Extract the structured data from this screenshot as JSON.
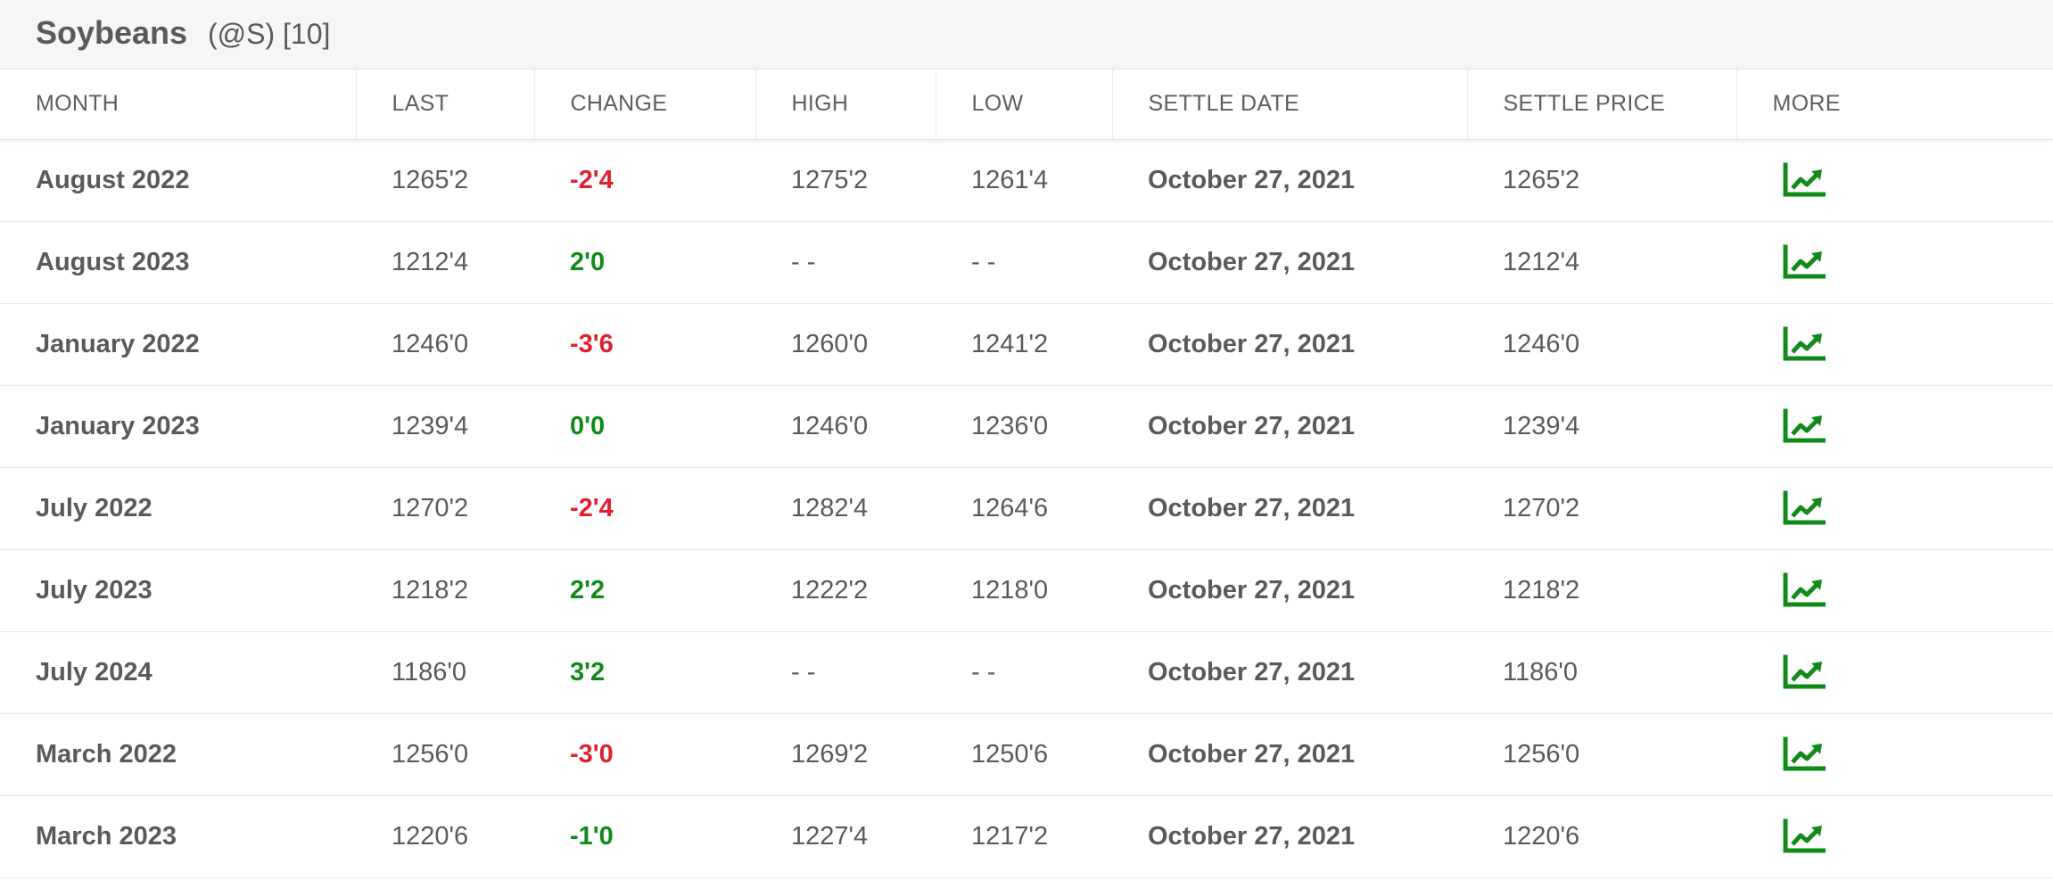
{
  "header": {
    "title": "Soybeans",
    "subtitle": "(@S) [10]"
  },
  "columns": [
    "MONTH",
    "LAST",
    "CHANGE",
    "HIGH",
    "LOW",
    "SETTLE DATE",
    "SETTLE PRICE",
    "MORE"
  ],
  "colors": {
    "negative": "#e0202e",
    "positive": "#118a19",
    "icon": "#118a19"
  },
  "rows": [
    {
      "month": "August 2022",
      "last": "1265'2",
      "change": "-2'4",
      "direction": "down",
      "high": "1275'2",
      "low": "1261'4",
      "settle_date": "October 27, 2021",
      "settle_price": "1265'2",
      "more_icon": "chart-line-icon"
    },
    {
      "month": "August 2023",
      "last": "1212'4",
      "change": "2'0",
      "direction": "up",
      "high": "- -",
      "low": "- -",
      "settle_date": "October 27, 2021",
      "settle_price": "1212'4",
      "more_icon": "chart-line-icon"
    },
    {
      "month": "January 2022",
      "last": "1246'0",
      "change": "-3'6",
      "direction": "down",
      "high": "1260'0",
      "low": "1241'2",
      "settle_date": "October 27, 2021",
      "settle_price": "1246'0",
      "more_icon": "chart-line-icon"
    },
    {
      "month": "January 2023",
      "last": "1239'4",
      "change": "0'0",
      "direction": "up",
      "high": "1246'0",
      "low": "1236'0",
      "settle_date": "October 27, 2021",
      "settle_price": "1239'4",
      "more_icon": "chart-line-icon"
    },
    {
      "month": "July 2022",
      "last": "1270'2",
      "change": "-2'4",
      "direction": "down",
      "high": "1282'4",
      "low": "1264'6",
      "settle_date": "October 27, 2021",
      "settle_price": "1270'2",
      "more_icon": "chart-line-icon"
    },
    {
      "month": "July 2023",
      "last": "1218'2",
      "change": "2'2",
      "direction": "up",
      "high": "1222'2",
      "low": "1218'0",
      "settle_date": "October 27, 2021",
      "settle_price": "1218'2",
      "more_icon": "chart-line-icon"
    },
    {
      "month": "July 2024",
      "last": "1186'0",
      "change": "3'2",
      "direction": "up",
      "high": "- -",
      "low": "- -",
      "settle_date": "October 27, 2021",
      "settle_price": "1186'0",
      "more_icon": "chart-line-icon"
    },
    {
      "month": "March 2022",
      "last": "1256'0",
      "change": "-3'0",
      "direction": "down",
      "high": "1269'2",
      "low": "1250'6",
      "settle_date": "October 27, 2021",
      "settle_price": "1256'0",
      "more_icon": "chart-line-icon"
    },
    {
      "month": "March 2023",
      "last": "1220'6",
      "change": "-1'0",
      "direction": "up",
      "high": "1227'4",
      "low": "1217'2",
      "settle_date": "October 27, 2021",
      "settle_price": "1220'6",
      "more_icon": "chart-line-icon"
    }
  ]
}
